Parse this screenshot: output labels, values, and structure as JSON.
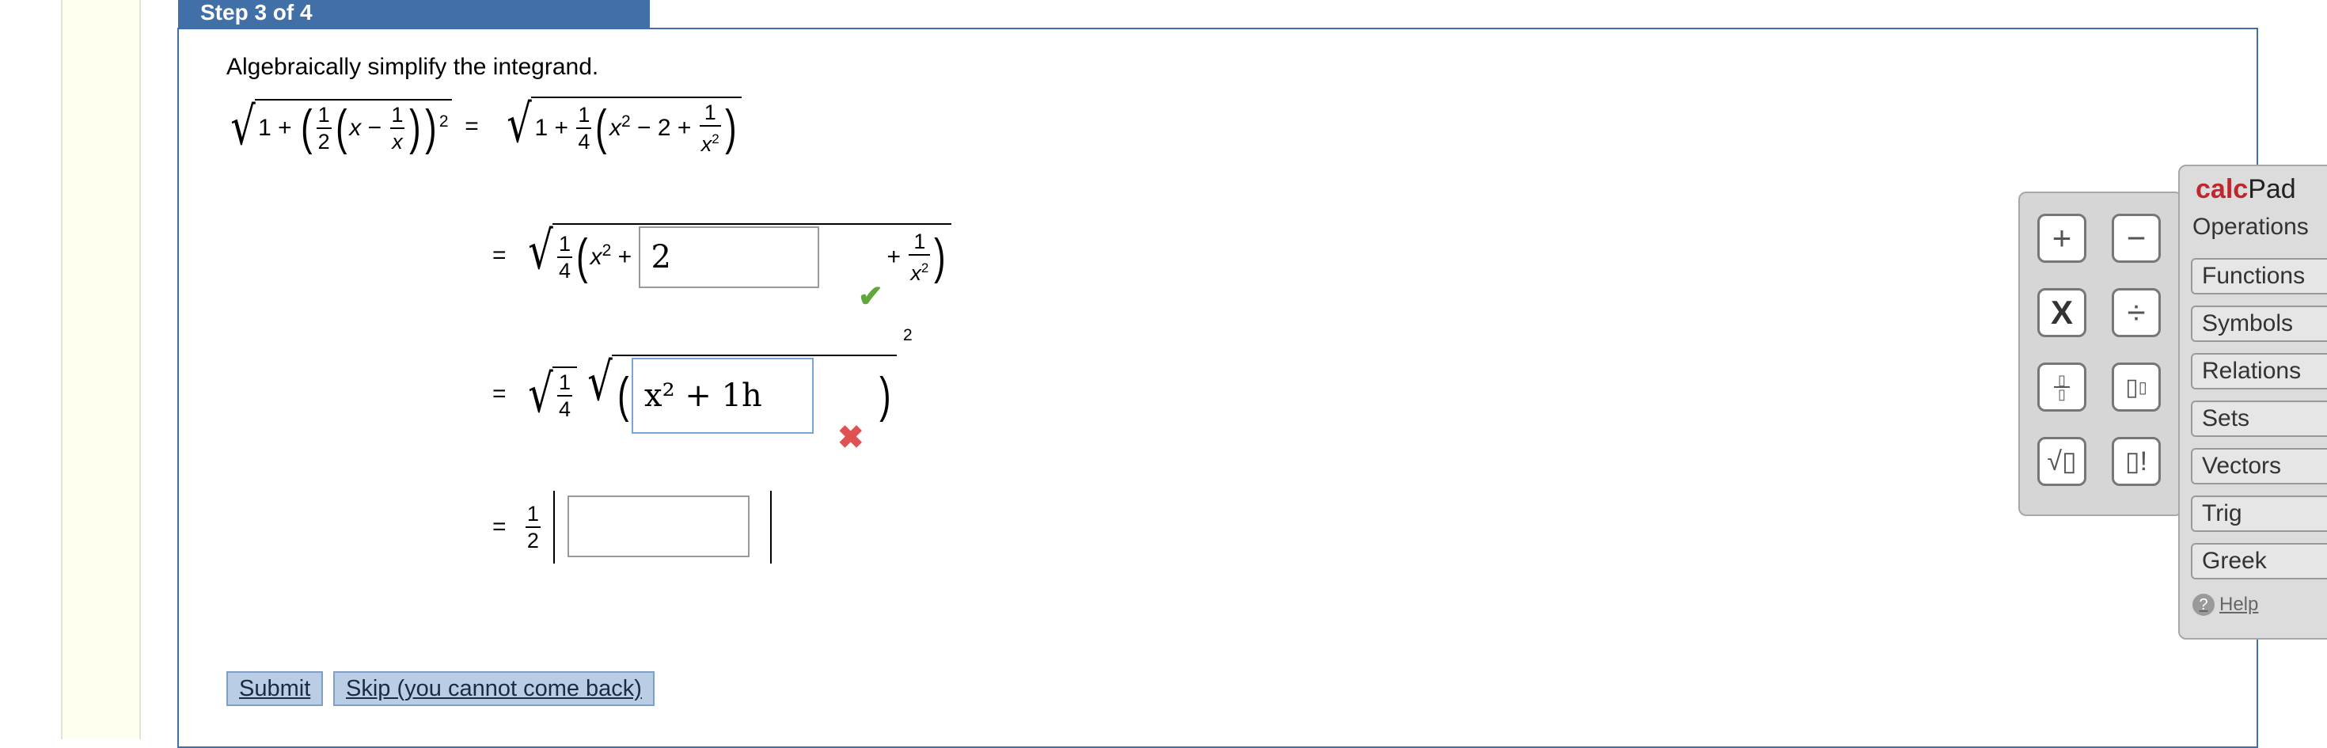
{
  "step_label": "Step 3 of 4",
  "instruction": "Algebraically simplify the integrand.",
  "answers": {
    "box1_value": "2",
    "box1_status": "correct",
    "box2_value": "x² + 1h",
    "box2_status": "incorrect",
    "box3_value": ""
  },
  "buttons": {
    "submit": "Submit",
    "skip": "Skip (you cannot come back)"
  },
  "calcpad": {
    "title_brand": "calc",
    "title_suffix": "Pad",
    "operations_label": "Operations",
    "tabs": [
      "Functions",
      "Symbols",
      "Relations",
      "Sets",
      "Vectors",
      "Trig",
      "Greek"
    ],
    "help": "Help",
    "keys": [
      "+",
      "−",
      "X",
      "÷",
      "fraction",
      "exponent",
      "√",
      "!"
    ]
  },
  "colors": {
    "accent": "#4170a8",
    "correct": "#5fa63b",
    "incorrect": "#e05252",
    "calcpad_brand": "#c0272d"
  }
}
